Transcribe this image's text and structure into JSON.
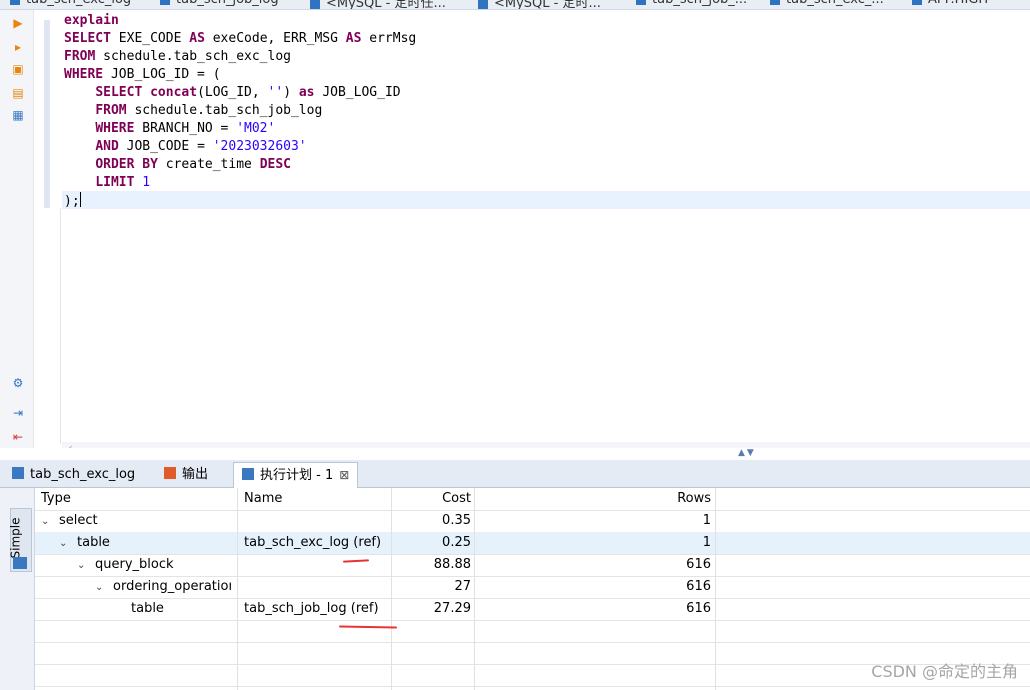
{
  "top_tabs": [
    "tab_sch_exc_log",
    "tab_sch_job_log",
    "<MySQL - 定时任...",
    "<MySQL - 定时...",
    "tab_sch_job_...",
    "tab_sch_exc_...",
    "APP.HIGH"
  ],
  "editor": {
    "lines": [
      [
        [
          "kw",
          "explain"
        ]
      ],
      [
        [
          "kw",
          "SELECT"
        ],
        [
          "t",
          " EXE_CODE "
        ],
        [
          "kw",
          "AS"
        ],
        [
          "t",
          " exeCode, ERR_MSG "
        ],
        [
          "kw",
          "AS"
        ],
        [
          "t",
          " errMsg"
        ]
      ],
      [
        [
          "kw",
          "FROM"
        ],
        [
          "t",
          " schedule.tab_sch_exc_log"
        ]
      ],
      [
        [
          "kw",
          "WHERE"
        ],
        [
          "t",
          " JOB_LOG_ID = ("
        ]
      ],
      [
        [
          "t",
          "    "
        ],
        [
          "kw",
          "SELECT"
        ],
        [
          "t",
          " "
        ],
        [
          "kw",
          "concat"
        ],
        [
          "t",
          "(LOG_ID, "
        ],
        [
          "str",
          "''"
        ],
        [
          "t",
          ") "
        ],
        [
          "kw",
          "as"
        ],
        [
          "t",
          " JOB_LOG_ID"
        ]
      ],
      [
        [
          "t",
          "    "
        ],
        [
          "kw",
          "FROM"
        ],
        [
          "t",
          " schedule.tab_sch_job_log"
        ]
      ],
      [
        [
          "t",
          "    "
        ],
        [
          "kw",
          "WHERE"
        ],
        [
          "t",
          " BRANCH_NO = "
        ],
        [
          "str",
          "'M02'"
        ]
      ],
      [
        [
          "t",
          "    "
        ],
        [
          "kw",
          "AND"
        ],
        [
          "t",
          " JOB_CODE = "
        ],
        [
          "str",
          "'2023032603'"
        ]
      ],
      [
        [
          "t",
          "    "
        ],
        [
          "kw",
          "ORDER BY"
        ],
        [
          "t",
          " create_time "
        ],
        [
          "kw",
          "DESC"
        ]
      ],
      [
        [
          "t",
          "    "
        ],
        [
          "kw",
          "LIMIT"
        ],
        [
          "t",
          " "
        ],
        [
          "num",
          "1"
        ]
      ],
      [
        [
          "t",
          ");"
        ]
      ]
    ]
  },
  "bottom_tabs": {
    "result": "tab_sch_exc_log",
    "output": "输出",
    "plan": "执行计划 - 1"
  },
  "side_tab": "Simple",
  "grid": {
    "headers": {
      "type": "Type",
      "name": "Name",
      "cost": "Cost",
      "rows": "Rows"
    },
    "rows": [
      {
        "depth": 0,
        "expanded": true,
        "type": "select",
        "name": "",
        "cost": "0.35",
        "rows": "1"
      },
      {
        "depth": 1,
        "expanded": true,
        "type": "table",
        "name": "tab_sch_exc_log (ref)",
        "cost": "0.25",
        "rows": "1"
      },
      {
        "depth": 2,
        "expanded": true,
        "type": "query_block",
        "name": "",
        "cost": "88.88",
        "rows": "616"
      },
      {
        "depth": 3,
        "expanded": true,
        "type": "ordering_operation",
        "name": "",
        "cost": "27",
        "rows": "616"
      },
      {
        "depth": 4,
        "expanded": null,
        "type": "table",
        "name": "tab_sch_job_log (ref)",
        "cost": "27.29",
        "rows": "616"
      }
    ],
    "selected_row": 1
  },
  "watermark": "CSDN @命定的主角",
  "colors": {
    "keyword": "#7f0055",
    "string": "#2a00ff",
    "selection": "#e5f1fb",
    "annotation": "#e53535"
  }
}
